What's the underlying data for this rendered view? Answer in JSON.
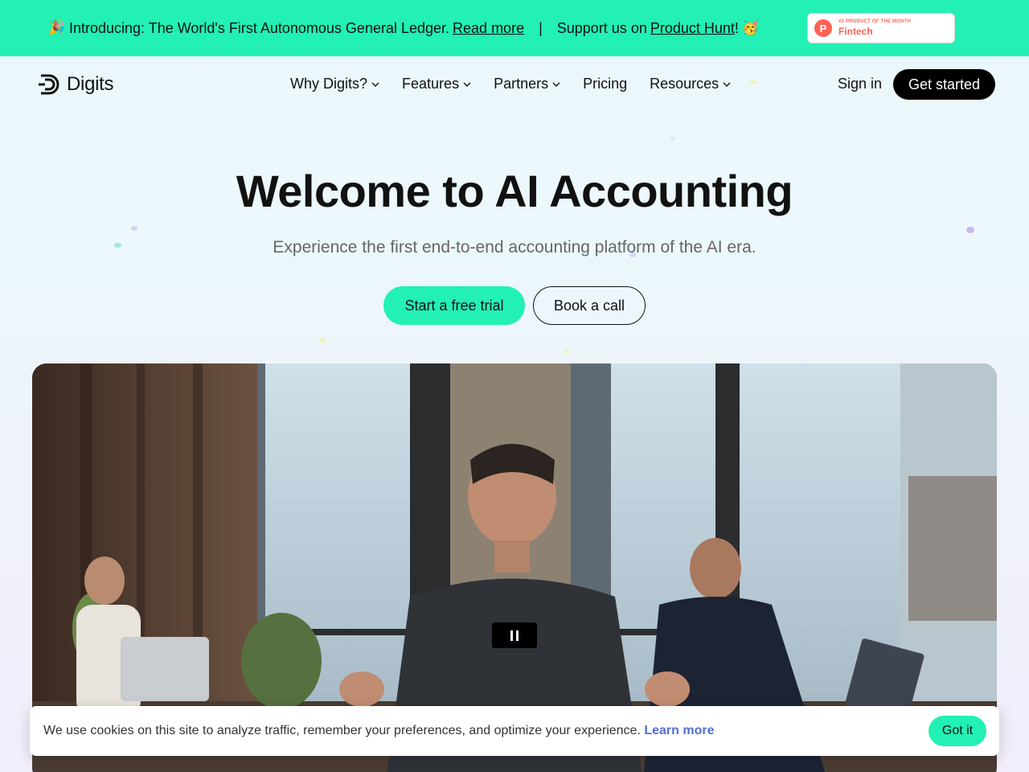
{
  "announcement": {
    "emoji_party": "🎉",
    "intro_text": "Introducing: The World's First Autonomous General Ledger.",
    "read_more": "Read more",
    "separator": "|",
    "support_prefix": "Support us on",
    "product_hunt": "Product Hunt",
    "support_suffix": "!",
    "emoji_celebrate": "🥳"
  },
  "product_hunt_badge": {
    "logo_letter": "P",
    "small_text": "#1 PRODUCT OF THE MONTH",
    "big_text": "Fintech"
  },
  "header": {
    "logo_text": "Digits",
    "nav": [
      {
        "label": "Why Digits?",
        "has_dropdown": true
      },
      {
        "label": "Features",
        "has_dropdown": true
      },
      {
        "label": "Partners",
        "has_dropdown": true
      },
      {
        "label": "Pricing",
        "has_dropdown": false
      },
      {
        "label": "Resources",
        "has_dropdown": true
      }
    ],
    "sign_in": "Sign in",
    "get_started": "Get started"
  },
  "hero": {
    "title": "Welcome to AI Accounting",
    "subtitle": "Experience the first end-to-end accounting platform of the AI era.",
    "primary_cta": "Start a free trial",
    "secondary_cta": "Book a call"
  },
  "video": {
    "state": "playing"
  },
  "cookie_banner": {
    "text": "We use cookies on this site to analyze traffic, remember your preferences, and optimize your experience.",
    "learn_more": "Learn more",
    "accept": "Got it"
  },
  "colors": {
    "accent": "#22f0b4",
    "text": "#111111",
    "link": "#5070d0",
    "product_hunt": "#ff6154"
  }
}
